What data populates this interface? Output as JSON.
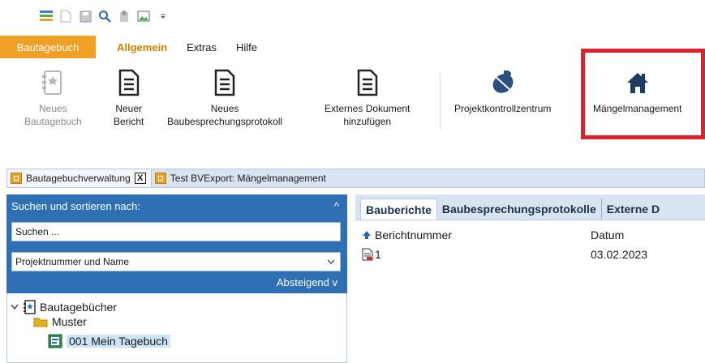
{
  "quick_access": {
    "icons": [
      "app-tree-icon",
      "new-document-icon",
      "save-icon",
      "search-icon",
      "tools-icon",
      "image-icon",
      "customize-dropdown-icon"
    ]
  },
  "ribbon_tabs": [
    {
      "label": "Bautagebuch"
    },
    {
      "label": "Allgemein"
    },
    {
      "label": "Extras"
    },
    {
      "label": "Hilfe"
    }
  ],
  "ribbon": {
    "buttons": [
      {
        "line1": "Neues",
        "line2": "Bautagebuch",
        "icon": "new-diary-icon"
      },
      {
        "line1": "Neuer",
        "line2": "Bericht",
        "icon": "new-report-icon"
      },
      {
        "line1": "Neues",
        "line2": "Baubesprechungsprotokoll",
        "icon": "new-protocol-icon"
      },
      {
        "line1": "Externes Dokument",
        "line2": "hinzufügen",
        "icon": "add-external-document-icon"
      },
      {
        "line1": "Projektkontrollzentrum",
        "line2": "",
        "icon": "satellite-icon"
      },
      {
        "line1": "Mängelmanagement",
        "line2": "",
        "icon": "house-icon"
      }
    ]
  },
  "doc_tabs": [
    {
      "label": "Bautagebuchverwaltung",
      "close": "X"
    },
    {
      "label": "Test BVExport: Mängelmanagement"
    }
  ],
  "left_panel": {
    "header": "Suchen und sortieren nach:",
    "collapse_glyph": "^",
    "search_placeholder": "Suchen ...",
    "sort_field": "Projektnummer und Name",
    "sort_order": "Absteigend v"
  },
  "tree": {
    "root": "Bautagebücher",
    "items": [
      "Muster",
      "001 Mein Tagebuch"
    ]
  },
  "right_panel": {
    "subtabs": [
      "Bauberichte",
      "Baubesprechungsprotokolle",
      "Externe D"
    ],
    "columns": [
      "Berichtnummer",
      "Datum"
    ],
    "rows": [
      {
        "number": "1",
        "date": "03.02.2023"
      }
    ]
  },
  "colors": {
    "accent_orange": "#f0a125",
    "active_tab_text": "#d27c00",
    "panel_blue": "#2f6fb4",
    "highlight_red": "#e0202a"
  }
}
